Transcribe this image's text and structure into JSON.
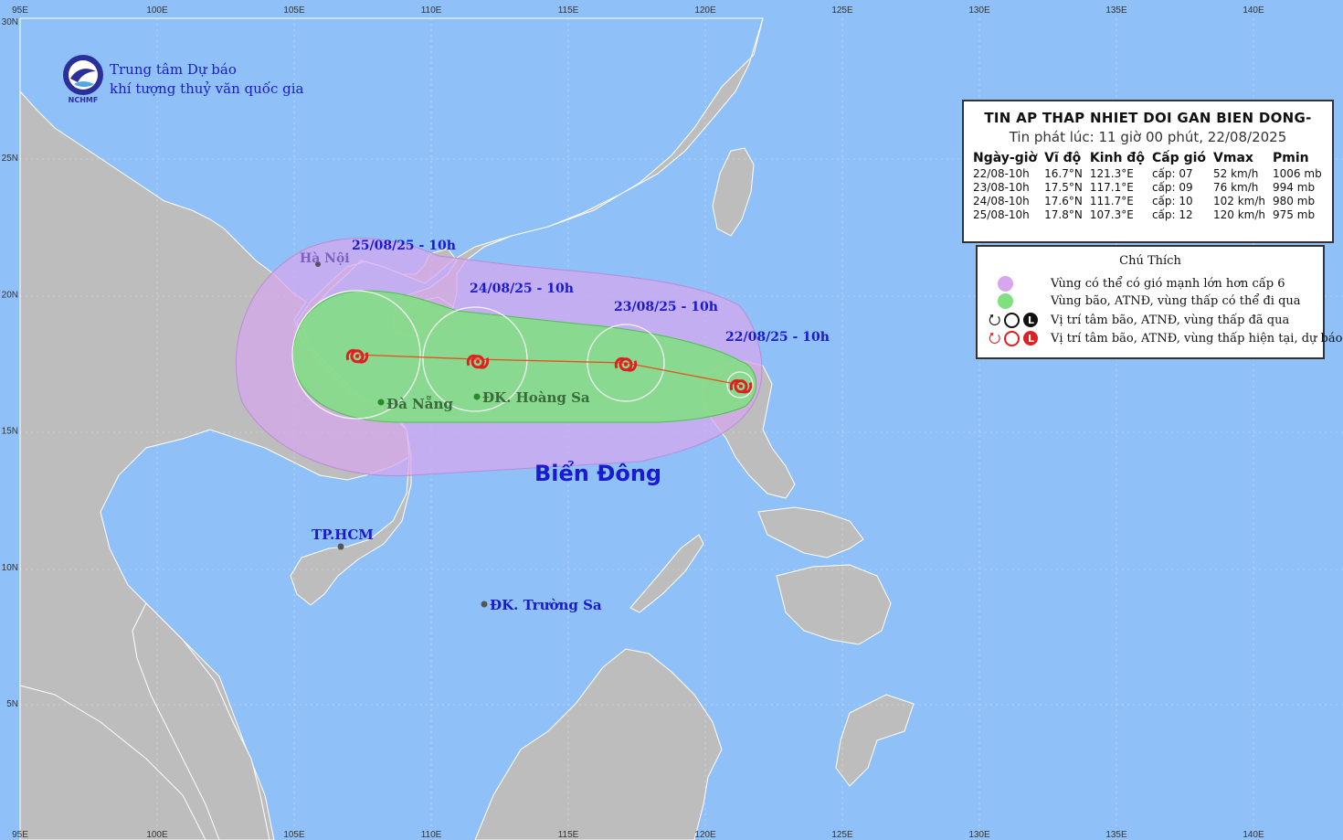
{
  "agency": {
    "line1": "Trung tâm Dự báo",
    "line2": "khí tượng thuỷ văn quốc gia",
    "logo_text": "NCHMF"
  },
  "bulletin": {
    "title": "TIN AP THAP NHIET DOI GAN BIEN DONG-",
    "issued": "Tin phát lúc: 11 giờ 00 phút, 22/08/2025",
    "headers": [
      "Ngày-giờ",
      "Vĩ độ",
      "Kinh độ",
      "Cấp gió",
      "Vmax",
      "Pmin"
    ],
    "rows": [
      [
        "22/08-10h",
        "16.7°N",
        "121.3°E",
        "cấp: 07",
        "52 km/h",
        "1006 mb"
      ],
      [
        "23/08-10h",
        "17.5°N",
        "117.1°E",
        "cấp: 09",
        "76 km/h",
        "994 mb"
      ],
      [
        "24/08-10h",
        "17.6°N",
        "111.7°E",
        "cấp: 10",
        "102 km/h",
        "980 mb"
      ],
      [
        "25/08-10h",
        "17.8°N",
        "107.3°E",
        "cấp: 12",
        "120 km/h",
        "975 mb"
      ]
    ]
  },
  "legend": {
    "title": "Chú Thích",
    "items": [
      {
        "text": "Vùng có thể có gió mạnh lớn hơn cấp 6",
        "color": "#d7a6ee"
      },
      {
        "text": "Vùng bão, ATNĐ, vùng thấp có thể đi qua",
        "color": "#7fe07f"
      },
      {
        "text": "Vị trí tâm bão, ATNĐ, vùng thấp đã qua",
        "color": "#111111"
      },
      {
        "text": "Vị trí tâm bão, ATNĐ, vùng thấp hiện tại, dự báo",
        "color": "#e02020"
      }
    ]
  },
  "labels": {
    "sea": "Biển Đông",
    "hanoi": "Hà Nội",
    "danang": "Đà Nẵng",
    "hoangsa": "ĐK. Hoàng Sa",
    "hcm": "TP.HCM",
    "truongsa": "ĐK. Trường Sa",
    "t1": "22/08/25 - 10h",
    "t2": "23/08/25 - 10h",
    "t3": "24/08/25 - 10h",
    "t4": "25/08/25 - 10h"
  },
  "axes": {
    "lon_labels": [
      "95E",
      "100E",
      "105E",
      "110E",
      "115E",
      "120E",
      "125E",
      "130E",
      "135E",
      "140E"
    ],
    "lat_labels": [
      "30N",
      "25N",
      "20N",
      "15N",
      "10N",
      "5N"
    ]
  },
  "track": [
    {
      "time": "22/08-10h",
      "lat": 16.7,
      "lon": 121.3
    },
    {
      "time": "23/08-10h",
      "lat": 17.5,
      "lon": 117.1
    },
    {
      "time": "24/08-10h",
      "lat": 17.6,
      "lon": 111.7
    },
    {
      "time": "25/08-10h",
      "lat": 17.8,
      "lon": 107.3
    }
  ],
  "colors": {
    "sea": "#8fc1f8",
    "land": "#bdbdbd",
    "wind_zone": "#d7a6ee",
    "storm_zone": "#7fe07f",
    "track": "#e8501a",
    "symbol": "#e02020",
    "text_blue": "#1a1ad0"
  }
}
